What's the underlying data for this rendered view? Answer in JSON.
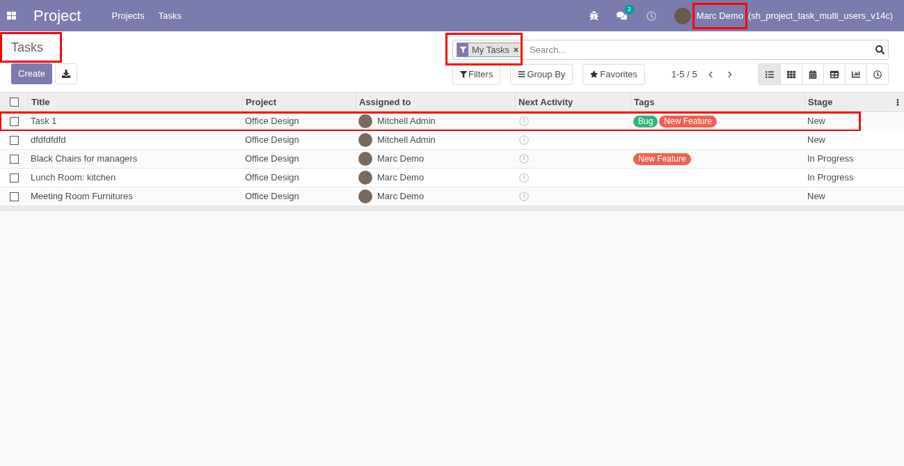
{
  "navbar": {
    "app_name": "Project",
    "menu": [
      "Projects",
      "Tasks"
    ],
    "messages_count": "2",
    "user_name": "Marc Demo",
    "user_name_highlighted": true,
    "database": "(sh_project_task_multi_users_v14c)"
  },
  "control_panel": {
    "title": "Tasks",
    "title_highlighted": true,
    "create_button": "Create",
    "search": {
      "facet": "My Tasks",
      "placeholder": "Search...",
      "highlighted": true
    },
    "filters": "Filters",
    "group_by": "Group By",
    "favorites": "Favorites",
    "pager": "1-5 / 5",
    "views": [
      {
        "kind": "list",
        "selected": true
      },
      {
        "kind": "kanban",
        "selected": false
      },
      {
        "kind": "calendar",
        "selected": false
      },
      {
        "kind": "pivot",
        "selected": false
      },
      {
        "kind": "graph",
        "selected": false
      },
      {
        "kind": "activity",
        "selected": false
      }
    ]
  },
  "table": {
    "all_checked": false,
    "columns": [
      "Title",
      "Project",
      "Assigned to",
      "Next Activity",
      "Tags",
      "Stage"
    ],
    "rows": [
      {
        "title": "Task 1",
        "project": "Office Design",
        "assignee": "Mitchell Admin",
        "tags": [
          {
            "label": "Bug",
            "color": "#30b47c"
          },
          {
            "label": "New Feature",
            "color": "#f06050"
          }
        ],
        "stage": "New",
        "highlighted": true,
        "checked": false
      },
      {
        "title": "dfdfdfdfd",
        "project": "Office Design",
        "assignee": "Mitchell Admin",
        "tags": [],
        "stage": "New",
        "highlighted": false,
        "checked": false
      },
      {
        "title": "Black Chairs for managers",
        "project": "Office Design",
        "assignee": "Marc Demo",
        "tags": [
          {
            "label": "New Feature",
            "color": "#f06050"
          }
        ],
        "stage": "In Progress",
        "highlighted": false,
        "checked": false
      },
      {
        "title": "Lunch Room: kitchen",
        "project": "Office Design",
        "assignee": "Marc Demo",
        "tags": [],
        "stage": "In Progress",
        "highlighted": false,
        "checked": false
      },
      {
        "title": "Meeting Room Furnitures",
        "project": "Office Design",
        "assignee": "Marc Demo",
        "tags": [],
        "stage": "New",
        "highlighted": false,
        "checked": false
      }
    ]
  }
}
